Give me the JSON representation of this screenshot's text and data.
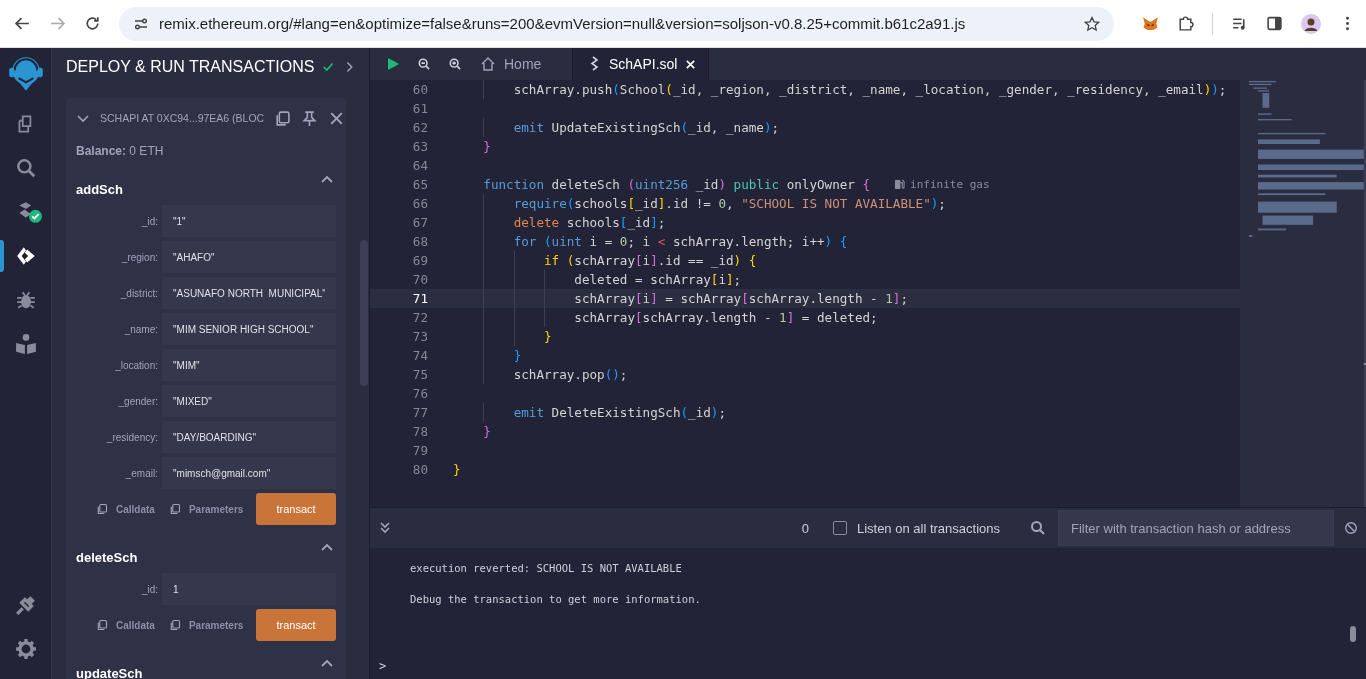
{
  "browser": {
    "url": "remix.ethereum.org/#lang=en&optimize=false&runs=200&evmVersion=null&version=soljson-v0.8.25+commit.b61c2a91.js",
    "forward_disabled": true
  },
  "rail_top": [
    {
      "kind": "files",
      "selected": false
    },
    {
      "kind": "search",
      "selected": false
    },
    {
      "kind": "compiler",
      "selected": false
    },
    {
      "kind": "deploy",
      "selected": true
    },
    {
      "kind": "debugger",
      "selected": false
    },
    {
      "kind": "learn",
      "selected": false
    }
  ],
  "rail_bottom": [
    {
      "kind": "plugins",
      "selected": false
    },
    {
      "kind": "settings",
      "selected": false
    }
  ],
  "panel": {
    "title": "DEPLOY & RUN TRANSACTIONS",
    "instance": {
      "title": "SCHAPI AT 0XC94...97EA6 (BLOC",
      "expanded": true,
      "balance": "**Balance:** 0 ETH",
      "functions": [
        {
          "name": "addSch",
          "expanded": true,
          "params": [
            {
              "label": "_id:",
              "value": "\"1\""
            },
            {
              "label": "_region:",
              "value": "\"AHAFO\""
            },
            {
              "label": "_district:",
              "value": "\"ASUNAFO NORTH  MUNICIPAL\""
            },
            {
              "label": "_name:",
              "value": "\"MIM SENIOR HIGH SCHOOL\""
            },
            {
              "label": "_location:",
              "value": "\"MIM\""
            },
            {
              "label": "_gender:",
              "value": "\"MIXED\""
            },
            {
              "label": "_residency:",
              "value": "\"DAY/BOARDING\""
            },
            {
              "label": "_email:",
              "value": "\"mimsch@gmail.com\""
            }
          ],
          "actions": {
            "calldata": "Calldata",
            "parameters": "Parameters",
            "submit": "transact"
          }
        },
        {
          "name": "deleteSch",
          "expanded": true,
          "params": [
            {
              "label": "_id:",
              "value": "1"
            }
          ],
          "actions": {
            "calldata": "Calldata",
            "parameters": "Parameters",
            "submit": "transact"
          }
        },
        {
          "name": "updateSch",
          "expanded": true
        }
      ]
    }
  },
  "editor": {
    "tabs": [
      {
        "kind": "home",
        "label": "Home",
        "selected": false
      },
      {
        "kind": "file",
        "label": "SchAPI.sol",
        "selected": true
      }
    ],
    "lines": [
      {
        "n": "60",
        "current": false,
        "tokens": [
          {
            "text": "        schArray.push",
            "kind": "p"
          },
          {
            "text": "(",
            "kind": "bl"
          },
          {
            "text": "School",
            "kind": "p"
          },
          {
            "text": "(",
            "kind": "y"
          },
          {
            "text": "_id, _region, _district, _name, _location, _gender, _residency, _email",
            "kind": "p"
          },
          {
            "text": ")",
            "kind": "y"
          },
          {
            "text": ")",
            "kind": "bl"
          },
          {
            "text": ";",
            "kind": "p"
          }
        ]
      },
      {
        "n": "61",
        "current": false
      },
      {
        "n": "62",
        "current": false,
        "tokens": [
          {
            "text": "        emit",
            "kind": "kw"
          },
          {
            "text": " UpdateExistingSch",
            "kind": "p"
          },
          {
            "text": "(",
            "kind": "bl"
          },
          {
            "text": "_id, _name",
            "kind": "p"
          },
          {
            "text": ")",
            "kind": "bl"
          },
          {
            "text": ";",
            "kind": "p"
          }
        ]
      },
      {
        "n": "63",
        "current": false,
        "tokens": [
          {
            "text": "    }",
            "kind": "pk"
          }
        ]
      },
      {
        "n": "64",
        "current": false
      },
      {
        "n": "65",
        "current": false,
        "hint": "infinite gas",
        "tokens": [
          {
            "text": "    function",
            "kind": "kw"
          },
          {
            "text": " deleteSch ",
            "kind": "p"
          },
          {
            "text": "(",
            "kind": "pk"
          },
          {
            "text": "uint256",
            "kind": "kw"
          },
          {
            "text": " _id",
            "kind": "p"
          },
          {
            "text": ")",
            "kind": "pk"
          },
          {
            "text": " public",
            "kind": "mod"
          },
          {
            "text": " onlyOwner ",
            "kind": "p"
          },
          {
            "text": "{",
            "kind": "pk"
          }
        ]
      },
      {
        "n": "66",
        "current": false,
        "tokens": [
          {
            "text": "        require",
            "kind": "kw"
          },
          {
            "text": "(",
            "kind": "bl"
          },
          {
            "text": "schools",
            "kind": "p"
          },
          {
            "text": "[",
            "kind": "y"
          },
          {
            "text": "_id",
            "kind": "p"
          },
          {
            "text": "]",
            "kind": "y"
          },
          {
            "text": ".id != ",
            "kind": "p"
          },
          {
            "text": "0",
            "kind": "num"
          },
          {
            "text": ", ",
            "kind": "p"
          },
          {
            "text": "\"SCHOOL IS NOT AVAILABLE\"",
            "kind": "str"
          },
          {
            "text": ")",
            "kind": "bl"
          },
          {
            "text": ";",
            "kind": "p"
          }
        ]
      },
      {
        "n": "67",
        "current": false,
        "tokens": [
          {
            "text": "        delete",
            "kind": "ctl"
          },
          {
            "text": " schools",
            "kind": "p"
          },
          {
            "text": "[",
            "kind": "bl"
          },
          {
            "text": "_id",
            "kind": "p"
          },
          {
            "text": "]",
            "kind": "bl"
          },
          {
            "text": ";",
            "kind": "p"
          }
        ]
      },
      {
        "n": "68",
        "current": false,
        "tokens": [
          {
            "text": "        for",
            "kind": "kw"
          },
          {
            "text": " (",
            "kind": "bl"
          },
          {
            "text": "uint",
            "kind": "kw"
          },
          {
            "text": " i = ",
            "kind": "p"
          },
          {
            "text": "0",
            "kind": "num"
          },
          {
            "text": "; i ",
            "kind": "p"
          },
          {
            "text": "<",
            "kind": "op"
          },
          {
            "text": " schArray.length; i++",
            "kind": "p"
          },
          {
            "text": ")",
            "kind": "bl"
          },
          {
            "text": " {",
            "kind": "bl"
          }
        ]
      },
      {
        "n": "69",
        "current": false,
        "tokens": [
          {
            "text": "            if",
            "kind": "y"
          },
          {
            "text": " (",
            "kind": "y"
          },
          {
            "text": "schArray",
            "kind": "p"
          },
          {
            "text": "[",
            "kind": "pk"
          },
          {
            "text": "i",
            "kind": "p"
          },
          {
            "text": "]",
            "kind": "pk"
          },
          {
            "text": ".id == _id",
            "kind": "p"
          },
          {
            "text": ")",
            "kind": "y"
          },
          {
            "text": " {",
            "kind": "y"
          }
        ]
      },
      {
        "n": "70",
        "current": false,
        "tokens": [
          {
            "text": "                deleted = schArray",
            "kind": "p"
          },
          {
            "text": "[",
            "kind": "y"
          },
          {
            "text": "i",
            "kind": "p"
          },
          {
            "text": "]",
            "kind": "y"
          },
          {
            "text": ";",
            "kind": "p"
          }
        ]
      },
      {
        "n": "71",
        "current": true,
        "tokens": [
          {
            "text": "                schArray",
            "kind": "p"
          },
          {
            "text": "[",
            "kind": "pk"
          },
          {
            "text": "i",
            "kind": "p"
          },
          {
            "text": "]",
            "kind": "pk"
          },
          {
            "text": " = schArray",
            "kind": "p"
          },
          {
            "text": "[",
            "kind": "pk"
          },
          {
            "text": "schArray.length - ",
            "kind": "p"
          },
          {
            "text": "1",
            "kind": "num"
          },
          {
            "text": "]",
            "kind": "pk"
          },
          {
            "text": ";",
            "kind": "p"
          }
        ]
      },
      {
        "n": "72",
        "current": false,
        "tokens": [
          {
            "text": "                schArray",
            "kind": "p"
          },
          {
            "text": "[",
            "kind": "pk"
          },
          {
            "text": "schArray.length - ",
            "kind": "p"
          },
          {
            "text": "1",
            "kind": "num"
          },
          {
            "text": "]",
            "kind": "pk"
          },
          {
            "text": " = deleted;",
            "kind": "p"
          }
        ]
      },
      {
        "n": "73",
        "current": false,
        "tokens": [
          {
            "text": "            }",
            "kind": "y"
          }
        ]
      },
      {
        "n": "74",
        "current": false,
        "tokens": [
          {
            "text": "        }",
            "kind": "bl"
          }
        ]
      },
      {
        "n": "75",
        "current": false,
        "tokens": [
          {
            "text": "        schArray.pop",
            "kind": "p"
          },
          {
            "text": "()",
            "kind": "bl"
          },
          {
            "text": ";",
            "kind": "p"
          }
        ]
      },
      {
        "n": "76",
        "current": false
      },
      {
        "n": "77",
        "current": false,
        "tokens": [
          {
            "text": "        emit",
            "kind": "kw"
          },
          {
            "text": " DeleteExistingSch",
            "kind": "p"
          },
          {
            "text": "(",
            "kind": "bl"
          },
          {
            "text": "_id",
            "kind": "p"
          },
          {
            "text": ")",
            "kind": "bl"
          },
          {
            "text": ";",
            "kind": "p"
          }
        ]
      },
      {
        "n": "78",
        "current": false,
        "tokens": [
          {
            "text": "    }",
            "kind": "pk"
          }
        ]
      },
      {
        "n": "79",
        "current": false
      },
      {
        "n": "80",
        "current": false,
        "tokens": [
          {
            "text": "}",
            "kind": "y"
          }
        ]
      }
    ]
  },
  "terminal": {
    "count": "0",
    "listen": {
      "label": "Listen on all transactions",
      "checked": false
    },
    "filter": {
      "placeholder": "Filter with transaction hash or address"
    },
    "output": [
      "execution reverted: SCHOOL IS NOT AVAILABLE",
      "Debug the transaction to get more information."
    ],
    "prompt": ">"
  }
}
